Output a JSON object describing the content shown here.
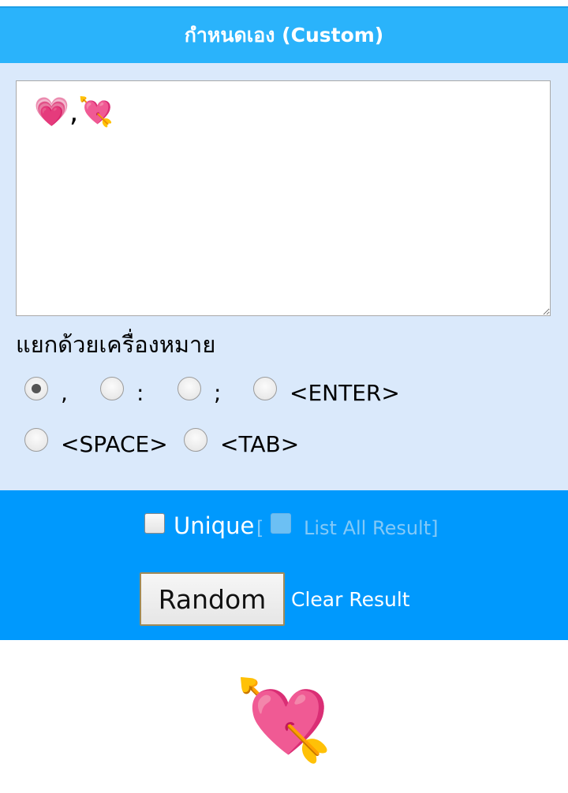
{
  "header": {
    "title": "กำหนดเอง (Custom)"
  },
  "input": {
    "value": "💗,💘"
  },
  "separator": {
    "label": "แยกด้วยเครื่องหมาย",
    "options": [
      {
        "label": ",",
        "checked": true
      },
      {
        "label": ":",
        "checked": false
      },
      {
        "label": ";",
        "checked": false
      },
      {
        "label": "<ENTER>",
        "checked": false
      },
      {
        "label": "<SPACE>",
        "checked": false
      },
      {
        "label": "<TAB>",
        "checked": false
      }
    ]
  },
  "controls": {
    "unique_label": "Unique",
    "unique_checked": false,
    "bracket_open": "[",
    "list_all_label": "List All Result]",
    "list_all_checked": false,
    "random_label": "Random",
    "clear_label": "Clear Result"
  },
  "result": {
    "value": "💘"
  },
  "colors": {
    "header_bg": "#2ab3fb",
    "panel_bg": "#dae9fb",
    "controls_bg": "#0099fd",
    "muted_text": "#83c9f7"
  }
}
